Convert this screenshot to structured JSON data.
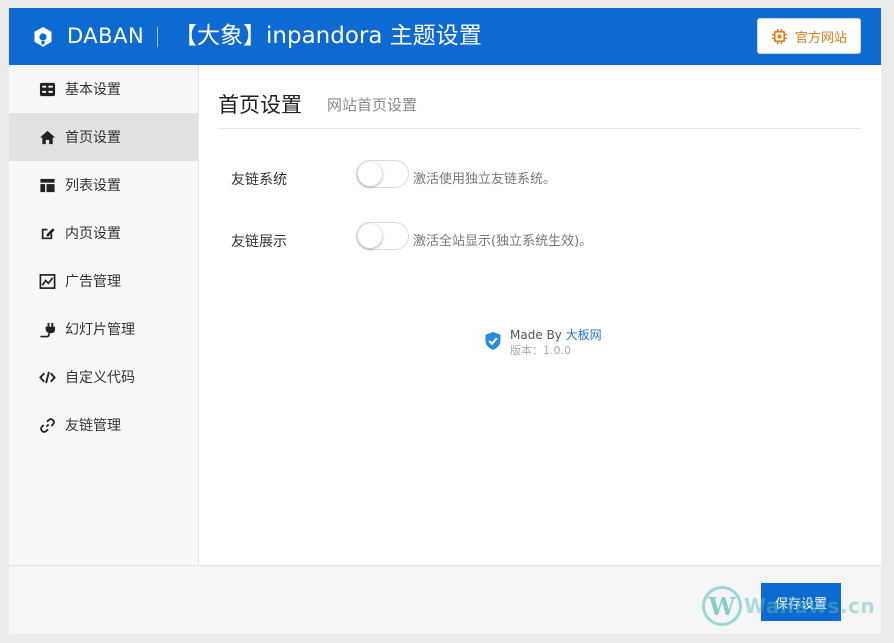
{
  "header": {
    "brand": "DABAN",
    "title": "【大象】inpandora 主题设置",
    "official_button": "官方网站"
  },
  "sidebar": {
    "items": [
      {
        "label": "基本设置",
        "icon": "dashboard-icon"
      },
      {
        "label": "首页设置",
        "icon": "home-icon",
        "active": true
      },
      {
        "label": "列表设置",
        "icon": "layout-icon"
      },
      {
        "label": "内页设置",
        "icon": "edit-icon"
      },
      {
        "label": "广告管理",
        "icon": "chart-icon"
      },
      {
        "label": "幻灯片管理",
        "icon": "plug-icon"
      },
      {
        "label": "自定义代码",
        "icon": "code-icon"
      },
      {
        "label": "友链管理",
        "icon": "link-icon"
      }
    ]
  },
  "section": {
    "title": "首页设置",
    "subtitle": "网站首页设置",
    "settings": [
      {
        "label": "友链系统",
        "description": "激活使用独立友链系统。",
        "enabled": false
      },
      {
        "label": "友链展示",
        "description": "激活全站显示(独立系统生效)。",
        "enabled": false
      }
    ]
  },
  "credit": {
    "made_by": "Made By ",
    "author": "大板网",
    "version": "版本：1.0.0"
  },
  "footer": {
    "save_button": "保存设置"
  },
  "watermark": {
    "letter": "W",
    "text": "Wailaws.cn"
  },
  "colors": {
    "primary": "#0d6ad0",
    "official_accent": "#e07b18",
    "sidebar_bg": "#f7f7f7",
    "sidebar_active": "#e2e2e2"
  }
}
